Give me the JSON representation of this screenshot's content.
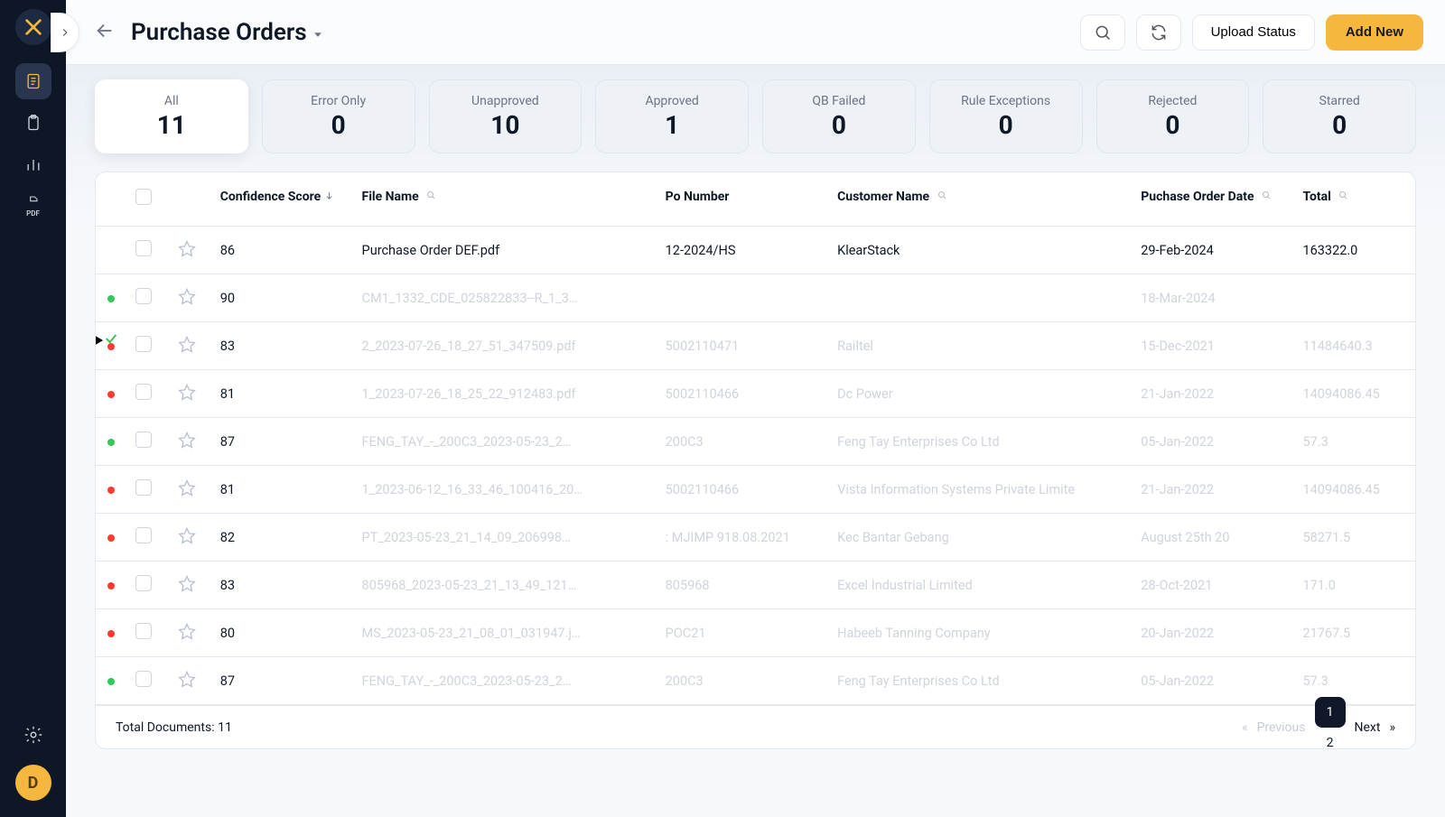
{
  "avatar_initial": "D",
  "header": {
    "title": "Purchase Orders",
    "upload_status": "Upload Status",
    "add_new": "Add New"
  },
  "stats": [
    {
      "label": "All",
      "value": "11",
      "active": true
    },
    {
      "label": "Error Only",
      "value": "0"
    },
    {
      "label": "Unapproved",
      "value": "10"
    },
    {
      "label": "Approved",
      "value": "1"
    },
    {
      "label": "QB Failed",
      "value": "0"
    },
    {
      "label": "Rule Exceptions",
      "value": "0"
    },
    {
      "label": "Rejected",
      "value": "0"
    },
    {
      "label": "Starred",
      "value": "0"
    }
  ],
  "columns": {
    "score": "Confidence Score",
    "file": "File Name",
    "po": "Po Number",
    "customer": "Customer Name",
    "date": "Puchase Order Date",
    "total": "Total"
  },
  "rows": [
    {
      "dot": "",
      "score": "86",
      "file": "Purchase Order DEF.pdf",
      "po": "12-2024/HS",
      "customer": "KlearStack",
      "date": "29-Feb-2024",
      "total": "163322.0",
      "dim": false
    },
    {
      "dot": "green",
      "score": "90",
      "file": "CM1_1332_CDE_025822833--R_1_3…",
      "po": "",
      "customer": "",
      "date": "18-Mar-2024",
      "total": "",
      "dim": true
    },
    {
      "dot": "red",
      "score": "83",
      "file": "2_2023-07-26_18_27_51_347509.pdf",
      "po": "5002110471",
      "customer": "Railtel",
      "date": "15-Dec-2021",
      "total": "11484640.3",
      "dim": true
    },
    {
      "dot": "red",
      "score": "81",
      "file": "1_2023-07-26_18_25_22_912483.pdf",
      "po": "5002110466",
      "customer": "Dc Power",
      "date": "21-Jan-2022",
      "total": "14094086.45",
      "dim": true
    },
    {
      "dot": "green",
      "score": "87",
      "file": "FENG_TAY_-_200C3_2023-05-23_2…",
      "po": "200C3",
      "customer": "Feng Tay Enterprises Co Ltd",
      "date": "05-Jan-2022",
      "total": "57.3",
      "dim": true
    },
    {
      "dot": "red",
      "score": "81",
      "file": "1_2023-06-12_16_33_46_100416_20…",
      "po": "5002110466",
      "customer": "Vista Information Systems Private Limite",
      "date": "21-Jan-2022",
      "total": "14094086.45",
      "dim": true
    },
    {
      "dot": "red",
      "score": "82",
      "file": "PT_2023-05-23_21_14_09_206998…",
      "po": ": MJIMP 918.08.2021",
      "customer": "Kec Bantar Gebang",
      "date": "August 25th 20",
      "total": "58271.5",
      "dim": true
    },
    {
      "dot": "red",
      "score": "83",
      "file": "805968_2023-05-23_21_13_49_121…",
      "po": "805968",
      "customer": "Excel Industrial Limited",
      "date": "28-Oct-2021",
      "total": "171.0",
      "dim": true
    },
    {
      "dot": "red",
      "score": "80",
      "file": "MS_2023-05-23_21_08_01_031947.j…",
      "po": "POC21",
      "customer": "Habeeb Tanning Company",
      "date": "20-Jan-2022",
      "total": "21767.5",
      "dim": true
    },
    {
      "dot": "green",
      "score": "87",
      "file": "FENG_TAY_-_200C3_2023-05-23_2…",
      "po": "200C3",
      "customer": "Feng Tay Enterprises Co Ltd",
      "date": "05-Jan-2022",
      "total": "57.3",
      "dim": true
    }
  ],
  "footer": {
    "total_docs_label": "Total Documents:",
    "total_docs_value": "11",
    "prev": "Previous",
    "next": "Next",
    "pages": [
      "1",
      "2"
    ],
    "current_page": "1"
  }
}
